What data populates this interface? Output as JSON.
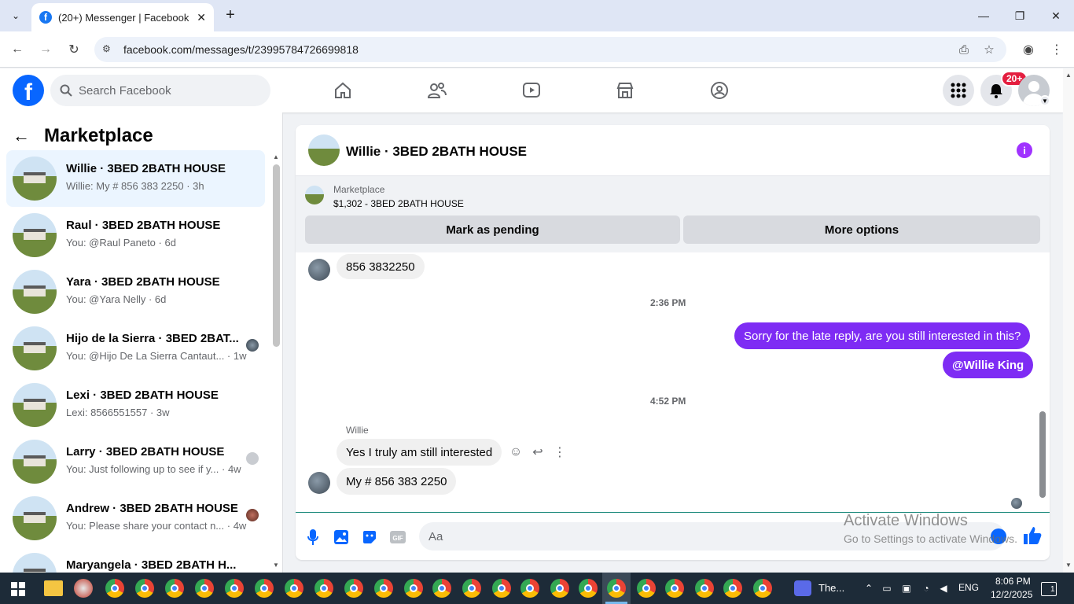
{
  "browser": {
    "tab_title": "(20+) Messenger | Facebook",
    "url": "facebook.com/messages/t/23995784726699818"
  },
  "header": {
    "search_placeholder": "Search Facebook",
    "notification_badge": "20+"
  },
  "sidebar": {
    "title": "Marketplace",
    "conversations": [
      {
        "name": "Willie · 3BED 2BATH HOUSE",
        "snippet": "Willie: My # 856 383 2250 · 3h",
        "active": true
      },
      {
        "name": "Raul · 3BED 2BATH HOUSE",
        "snippet": "You: @Raul Paneto · 6d"
      },
      {
        "name": "Yara · 3BED 2BATH HOUSE",
        "snippet": "You: @Yara Nelly · 6d"
      },
      {
        "name": "Hijo de la Sierra · 3BED 2BAT...",
        "snippet": "You: @Hijo De La Sierra Cantaut... · 1w"
      },
      {
        "name": "Lexi · 3BED 2BATH HOUSE",
        "snippet": "Lexi: 8566551557 · 3w"
      },
      {
        "name": "Larry · 3BED 2BATH HOUSE",
        "snippet": "You: Just following up to see if y... · 4w"
      },
      {
        "name": "Andrew · 3BED 2BATH HOUSE",
        "snippet": "You: Please share your contact n... · 4w"
      },
      {
        "name": "Maryangela · 3BED 2BATH H...",
        "snippet": ""
      }
    ]
  },
  "chat": {
    "title": "Willie · 3BED 2BATH HOUSE",
    "marketplace_label": "Marketplace",
    "listing": "$1,302 - 3BED 2BATH HOUSE",
    "mark_pending": "Mark as pending",
    "more_options": "More options",
    "messages": {
      "in1": "856 3832250",
      "ts1": "2:36 PM",
      "out1": "Sorry for the late reply, are you still interested in this?",
      "out2": "@Willie King",
      "ts2": "4:52 PM",
      "sender": "Willie",
      "in2": "Yes I truly am still interested",
      "in3": "My # 856 383 2250"
    },
    "composer_placeholder": "Aa"
  },
  "watermark": {
    "line1": "Activate Windows",
    "line2": "Go to Settings to activate Windows."
  },
  "taskbar": {
    "app_label": "The...",
    "lang": "ENG",
    "time": "8:06 PM",
    "date": "12/2/2025",
    "notif_count": "1"
  }
}
